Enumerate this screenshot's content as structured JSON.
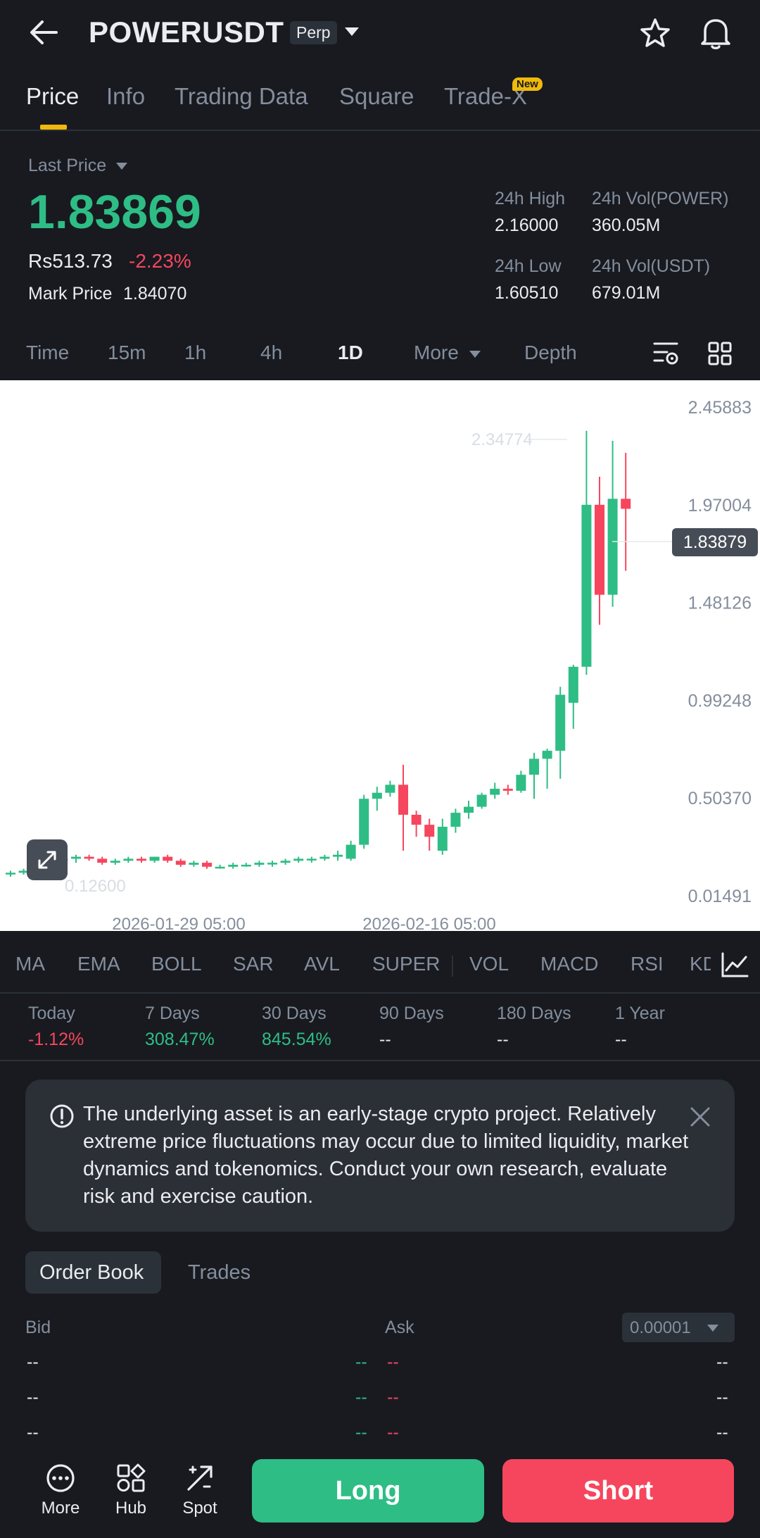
{
  "header": {
    "symbol": "POWERUSDT",
    "contract_type": "Perp"
  },
  "tabs": [
    {
      "label": "Price"
    },
    {
      "label": "Info"
    },
    {
      "label": "Trading Data"
    },
    {
      "label": "Square"
    },
    {
      "label": "Trade-X"
    }
  ],
  "new_badge": "New",
  "price": {
    "selector_label": "Last Price",
    "last_price": "1.83869",
    "fiat_value": "Rs513.73",
    "change_pct": "-2.23%",
    "mark_price_label": "Mark Price",
    "mark_price": "1.84070"
  },
  "stats": {
    "high_label": "24h High",
    "high": "2.16000",
    "vol_base_label": "24h Vol(POWER)",
    "vol_base": "360.05M",
    "low_label": "24h Low",
    "low": "1.60510",
    "vol_quote_label": "24h Vol(USDT)",
    "vol_quote": "679.01M"
  },
  "intervals": [
    "Time",
    "15m",
    "1h",
    "4h",
    "1D",
    "More",
    "Depth"
  ],
  "active_interval": "1D",
  "chart_data": {
    "type": "candlestick",
    "y_ticks": [
      "2.45883",
      "1.97004",
      "1.48126",
      "0.99248",
      "0.50370",
      "0.01491"
    ],
    "ylim": [
      0.01491,
      2.45883
    ],
    "x_ticks": [
      "2026-01-29 05:00",
      "2026-02-16 05:00"
    ],
    "high_label": "2.34774",
    "low_label": "0.12600",
    "current_price_label": "1.83879",
    "candles": [
      {
        "o": 0.13,
        "h": 0.14,
        "l": 0.11,
        "c": 0.13
      },
      {
        "o": 0.13,
        "h": 0.15,
        "l": 0.12,
        "c": 0.14
      },
      {
        "o": 0.14,
        "h": 0.19,
        "l": 0.13,
        "c": 0.18
      },
      {
        "o": 0.18,
        "h": 0.2,
        "l": 0.16,
        "c": 0.19
      },
      {
        "o": 0.19,
        "h": 0.21,
        "l": 0.17,
        "c": 0.2
      },
      {
        "o": 0.2,
        "h": 0.22,
        "l": 0.18,
        "c": 0.21
      },
      {
        "o": 0.21,
        "h": 0.22,
        "l": 0.19,
        "c": 0.2
      },
      {
        "o": 0.2,
        "h": 0.21,
        "l": 0.17,
        "c": 0.18
      },
      {
        "o": 0.18,
        "h": 0.2,
        "l": 0.17,
        "c": 0.19
      },
      {
        "o": 0.19,
        "h": 0.21,
        "l": 0.18,
        "c": 0.2
      },
      {
        "o": 0.2,
        "h": 0.21,
        "l": 0.18,
        "c": 0.19
      },
      {
        "o": 0.19,
        "h": 0.21,
        "l": 0.18,
        "c": 0.21
      },
      {
        "o": 0.21,
        "h": 0.22,
        "l": 0.18,
        "c": 0.19
      },
      {
        "o": 0.19,
        "h": 0.2,
        "l": 0.16,
        "c": 0.17
      },
      {
        "o": 0.17,
        "h": 0.19,
        "l": 0.16,
        "c": 0.18
      },
      {
        "o": 0.18,
        "h": 0.19,
        "l": 0.15,
        "c": 0.16
      },
      {
        "o": 0.16,
        "h": 0.17,
        "l": 0.15,
        "c": 0.16
      },
      {
        "o": 0.16,
        "h": 0.18,
        "l": 0.15,
        "c": 0.17
      },
      {
        "o": 0.17,
        "h": 0.18,
        "l": 0.16,
        "c": 0.17
      },
      {
        "o": 0.17,
        "h": 0.19,
        "l": 0.16,
        "c": 0.18
      },
      {
        "o": 0.18,
        "h": 0.19,
        "l": 0.16,
        "c": 0.18
      },
      {
        "o": 0.18,
        "h": 0.2,
        "l": 0.17,
        "c": 0.19
      },
      {
        "o": 0.19,
        "h": 0.21,
        "l": 0.18,
        "c": 0.2
      },
      {
        "o": 0.2,
        "h": 0.21,
        "l": 0.18,
        "c": 0.2
      },
      {
        "o": 0.2,
        "h": 0.22,
        "l": 0.19,
        "c": 0.21
      },
      {
        "o": 0.21,
        "h": 0.24,
        "l": 0.19,
        "c": 0.22
      },
      {
        "o": 0.2,
        "h": 0.29,
        "l": 0.19,
        "c": 0.27
      },
      {
        "o": 0.27,
        "h": 0.52,
        "l": 0.25,
        "c": 0.5
      },
      {
        "o": 0.5,
        "h": 0.56,
        "l": 0.44,
        "c": 0.53
      },
      {
        "o": 0.53,
        "h": 0.59,
        "l": 0.51,
        "c": 0.57
      },
      {
        "o": 0.57,
        "h": 0.67,
        "l": 0.24,
        "c": 0.42
      },
      {
        "o": 0.42,
        "h": 0.44,
        "l": 0.31,
        "c": 0.37
      },
      {
        "o": 0.37,
        "h": 0.4,
        "l": 0.24,
        "c": 0.31
      },
      {
        "o": 0.24,
        "h": 0.4,
        "l": 0.22,
        "c": 0.36
      },
      {
        "o": 0.36,
        "h": 0.45,
        "l": 0.33,
        "c": 0.43
      },
      {
        "o": 0.43,
        "h": 0.49,
        "l": 0.4,
        "c": 0.46
      },
      {
        "o": 0.46,
        "h": 0.53,
        "l": 0.45,
        "c": 0.52
      },
      {
        "o": 0.52,
        "h": 0.58,
        "l": 0.5,
        "c": 0.55
      },
      {
        "o": 0.55,
        "h": 0.57,
        "l": 0.52,
        "c": 0.54
      },
      {
        "o": 0.54,
        "h": 0.64,
        "l": 0.53,
        "c": 0.62
      },
      {
        "o": 0.62,
        "h": 0.73,
        "l": 0.5,
        "c": 0.7
      },
      {
        "o": 0.7,
        "h": 0.75,
        "l": 0.55,
        "c": 0.74
      },
      {
        "o": 0.74,
        "h": 1.06,
        "l": 0.6,
        "c": 1.02
      },
      {
        "o": 0.98,
        "h": 1.17,
        "l": 0.85,
        "c": 1.16
      },
      {
        "o": 1.16,
        "h": 2.34,
        "l": 1.12,
        "c": 1.97
      },
      {
        "o": 1.97,
        "h": 2.11,
        "l": 1.37,
        "c": 1.52
      },
      {
        "o": 1.52,
        "h": 2.29,
        "l": 1.46,
        "c": 2.0
      },
      {
        "o": 2.0,
        "h": 2.23,
        "l": 1.64,
        "c": 1.95
      }
    ]
  },
  "indicators": [
    "MA",
    "EMA",
    "BOLL",
    "SAR",
    "AVL",
    "SUPER",
    "VOL",
    "MACD",
    "RSI",
    "KD"
  ],
  "performance": [
    {
      "label": "Today",
      "value": "-1.12%"
    },
    {
      "label": "7 Days",
      "value": "308.47%"
    },
    {
      "label": "30 Days",
      "value": "845.54%"
    },
    {
      "label": "90 Days",
      "value": "--"
    },
    {
      "label": "180 Days",
      "value": "--"
    },
    {
      "label": "1 Year",
      "value": "--"
    }
  ],
  "notice": "The underlying asset is an early-stage crypto project. Relatively extreme price fluctuations may occur due to limited liquidity, market dynamics and tokenomics. Conduct your own research, evaluate risk and exercise caution.",
  "orderbook": {
    "tab_active": "Order Book",
    "tab_other": "Trades",
    "bid_label": "Bid",
    "ask_label": "Ask",
    "precision": "0.00001",
    "placeholder": "--"
  },
  "bottom": {
    "more": "More",
    "hub": "Hub",
    "spot": "Spot",
    "long": "Long",
    "short": "Short"
  },
  "colors": {
    "up": "#2ebd85",
    "down": "#f6465d",
    "accent": "#f0b90b",
    "bg": "#181a20"
  }
}
